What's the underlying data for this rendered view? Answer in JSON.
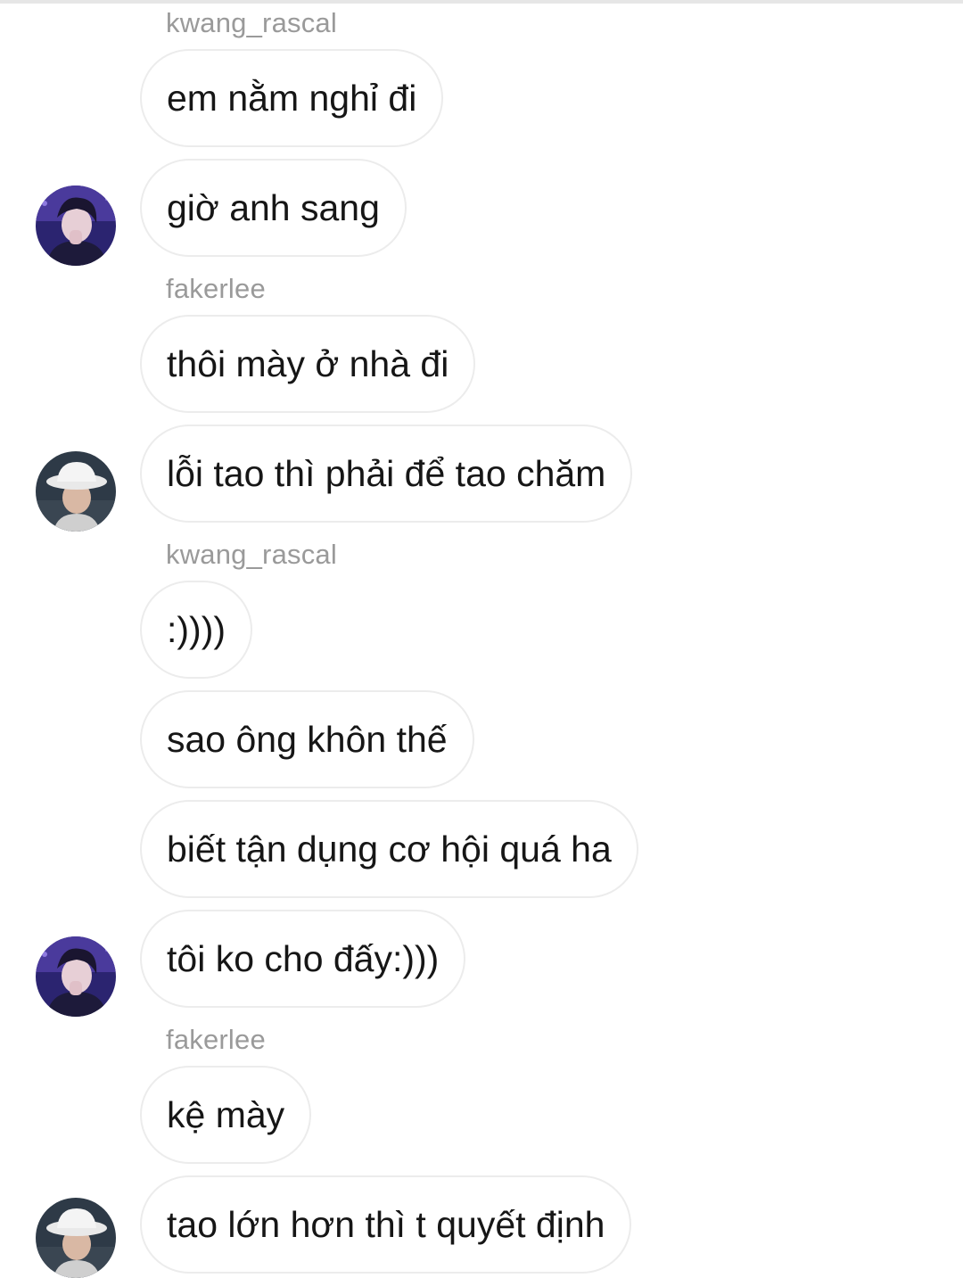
{
  "thread": {
    "senders": [
      "kwang_rascal",
      "fakerlee",
      "kwang_rascal",
      "fakerlee"
    ],
    "messages": [
      "em nằm nghỉ đi",
      "giờ anh sang",
      "thôi mày ở nhà đi",
      "lỗi tao thì phải để tao chăm",
      ":))))",
      "sao ông khôn thế",
      "biết tận dụng cơ hội quá ha",
      "tôi ko cho đấy:)))",
      "kệ mày",
      "tao lớn hơn thì t quyết định"
    ]
  },
  "colors": {
    "sender_text": "#9a9a9a",
    "bubble_border": "#ececec",
    "message_text": "#161616"
  },
  "icons": {
    "kwang_avatar": "avatar-dark-hair-purple-stage",
    "faker_avatar": "avatar-bucket-hat"
  }
}
